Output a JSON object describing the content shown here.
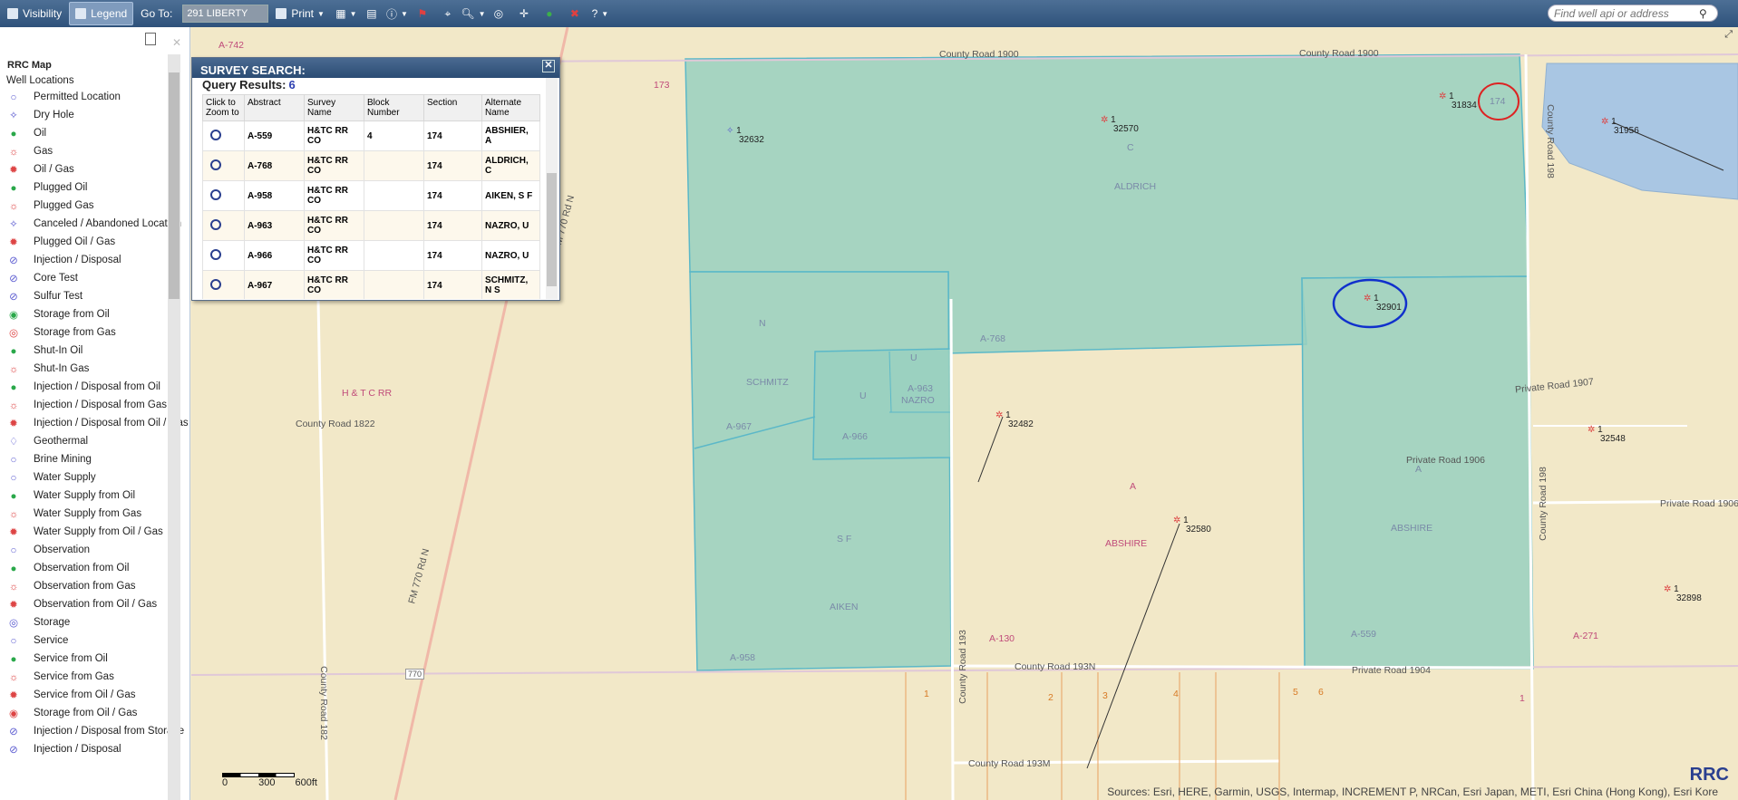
{
  "toolbar": {
    "visibility": "Visibility",
    "legend": "Legend",
    "goto_label": "Go To:",
    "goto_value": "291 LIBERTY",
    "print": "Print",
    "search_placeholder": "Find well api or address"
  },
  "legend": {
    "title": "RRC Map",
    "subtitle": "Well Locations",
    "items": [
      "Permitted Location",
      "Dry Hole",
      "Oil",
      "Gas",
      "Oil / Gas",
      "Plugged Oil",
      "Plugged Gas",
      "Canceled / Abandoned Location",
      "Plugged Oil / Gas",
      "Injection / Disposal",
      "Core Test",
      "Sulfur Test",
      "Storage from Oil",
      "Storage from Gas",
      "Shut-In Oil",
      "Shut-In Gas",
      "Injection / Disposal from Oil",
      "Injection / Disposal from Gas",
      "Injection / Disposal from Oil / Gas",
      "Geothermal",
      "Brine Mining",
      "Water Supply",
      "Water Supply from Oil",
      "Water Supply from Gas",
      "Water Supply from Oil / Gas",
      "Observation",
      "Observation from Oil",
      "Observation from Gas",
      "Observation from Oil / Gas",
      "Storage",
      "Service",
      "Service from Oil",
      "Service from Gas",
      "Service from Oil / Gas",
      "Storage from Oil / Gas",
      "Injection / Disposal from Storage",
      "Injection / Disposal"
    ]
  },
  "popup": {
    "title": "SURVEY SEARCH:",
    "query_label": "Query Results:",
    "query_count": "6",
    "columns": [
      "Click to Zoom to",
      "Abstract",
      "Survey Name",
      "Block Number",
      "Section",
      "Alternate Name"
    ],
    "rows": [
      {
        "abstract": "A-559",
        "survey": "H&TC RR CO",
        "block": "4",
        "section": "174",
        "alt": "ABSHIER, A"
      },
      {
        "abstract": "A-768",
        "survey": "H&TC RR CO",
        "block": "",
        "section": "174",
        "alt": "ALDRICH, C"
      },
      {
        "abstract": "A-958",
        "survey": "H&TC RR CO",
        "block": "",
        "section": "174",
        "alt": "AIKEN, S F"
      },
      {
        "abstract": "A-963",
        "survey": "H&TC RR CO",
        "block": "",
        "section": "174",
        "alt": "NAZRO, U"
      },
      {
        "abstract": "A-966",
        "survey": "H&TC RR CO",
        "block": "",
        "section": "174",
        "alt": "NAZRO, U"
      },
      {
        "abstract": "A-967",
        "survey": "H&TC RR CO",
        "block": "",
        "section": "174",
        "alt": "SCHMITZ, N S"
      }
    ]
  },
  "map": {
    "roads": [
      "County Road 1900",
      "County Road 1900",
      "County Road 198",
      "Private Road 1907",
      "Private Road 1906",
      "Private Road 1906",
      "County Road 1822",
      "FM 770 Rd N",
      "FM 770 Rd N",
      "County Road 193N",
      "Private Road 1904",
      "County Road 193M",
      "County Road 182",
      "County Road 193",
      "County Road 198"
    ],
    "surveys": [
      "A-742",
      "173",
      "ALDRICH",
      "C",
      "N",
      "SCHMITZ",
      "U",
      "U",
      "A-963",
      "NAZRO",
      "A-967",
      "A-966",
      "A-768",
      "H & T C RR",
      "A",
      "ABSHIRE",
      "S F",
      "AIKEN",
      "A-958",
      "A-130",
      "A",
      "ABSHIRE",
      "A-559",
      "A-271",
      "174",
      "770"
    ],
    "wells": [
      {
        "num": "1",
        "id": "32632"
      },
      {
        "num": "1",
        "id": "32570"
      },
      {
        "num": "1",
        "id": "31834"
      },
      {
        "num": "1",
        "id": "31956"
      },
      {
        "num": "1",
        "id": "32901"
      },
      {
        "num": "1",
        "id": "32482"
      },
      {
        "num": "1",
        "id": "32548"
      },
      {
        "num": "1",
        "id": "32580"
      },
      {
        "num": "1",
        "id": "32898"
      }
    ],
    "tracts": [
      "1",
      "2",
      "3",
      "4",
      "5",
      "6",
      "1"
    ],
    "scale": {
      "zero": "0",
      "mid": "300",
      "end": "600ft"
    },
    "sources": "Sources: Esri, HERE, Garmin, USGS, Intermap, INCREMENT P, NRCan, Esri Japan, METI, Esri China (Hong Kong), Esri Kore",
    "logo": "RRC"
  }
}
